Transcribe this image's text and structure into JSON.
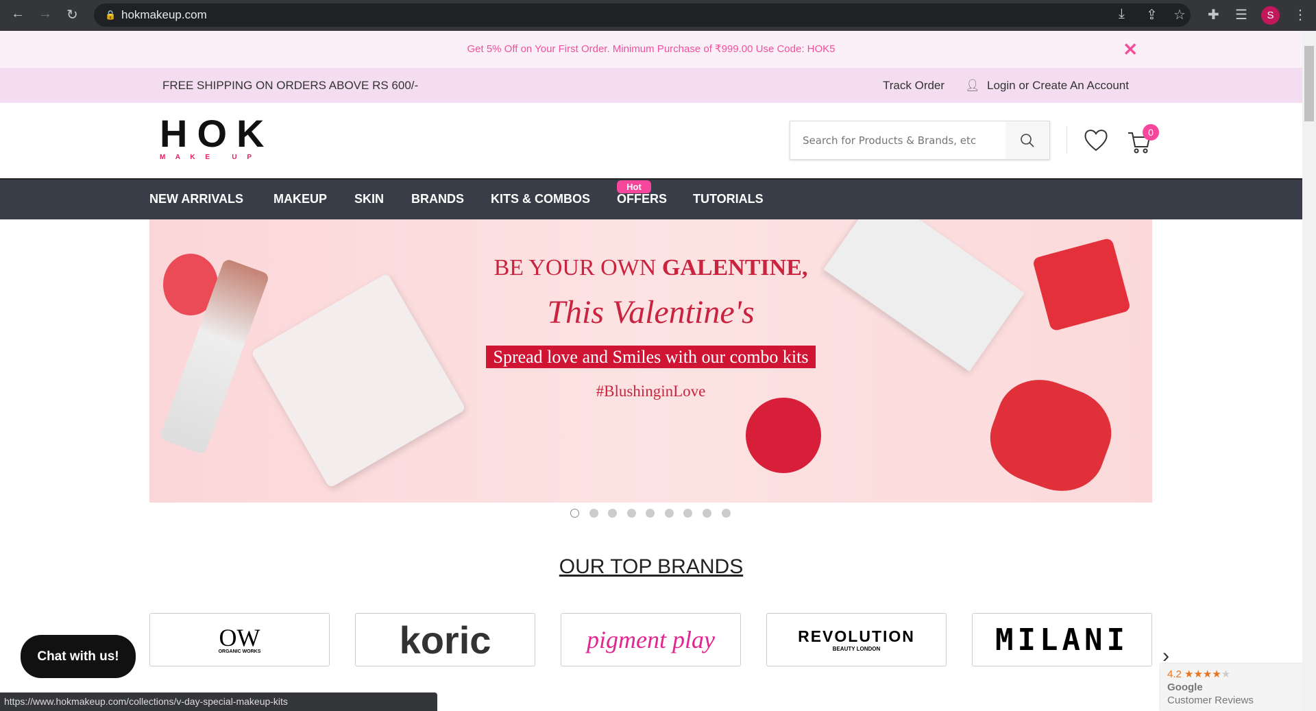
{
  "browser": {
    "url": "hokmakeup.com",
    "profile_initial": "S",
    "status_url": "https://www.hokmakeup.com/collections/v-day-special-makeup-kits"
  },
  "promo": {
    "text": "Get 5% Off on Your First Order. Minimum Purchase of ₹999.00 Use Code: HOK5"
  },
  "topbar": {
    "shipping": "FREE SHIPPING ON ORDERS ABOVE RS 600/-",
    "track": "Track Order",
    "login": "Login or Create An Account"
  },
  "header": {
    "logo": "HOK",
    "logo_sub": "M A K E   U P",
    "search_placeholder": "Search for Products & Brands, etc",
    "cart_count": "0"
  },
  "nav": {
    "items": [
      "NEW ARRIVALS",
      "MAKEUP",
      "SKIN",
      "BRANDS",
      "KITS & COMBOS",
      "OFFERS",
      "TUTORIALS"
    ],
    "hot": "Hot"
  },
  "banner": {
    "line1": "BE YOUR OWN ",
    "line1_bold": "GALENTINE,",
    "line2": "This Valentine's",
    "line3": "Spread love and Smiles with our combo kits",
    "line4": "#BlushinginLove",
    "slides": 9,
    "active_slide": 1
  },
  "brands": {
    "title": "OUR TOP BRANDS",
    "items": [
      "OW",
      "koric",
      "pigment play",
      "REVOLUTION",
      "MILANI"
    ],
    "revolution_sub": "BEAUTY LONDON",
    "ow_sub": "ORGANIC WORKS"
  },
  "chat": {
    "label": "Chat with us!"
  },
  "reviews": {
    "rating": "4.2",
    "stars": 4.2,
    "line1": "Google",
    "line2": "Customer Reviews"
  },
  "colors": {
    "accent": "#f7479c",
    "nav_bg": "#383d47",
    "banner_red": "#c8243f"
  }
}
